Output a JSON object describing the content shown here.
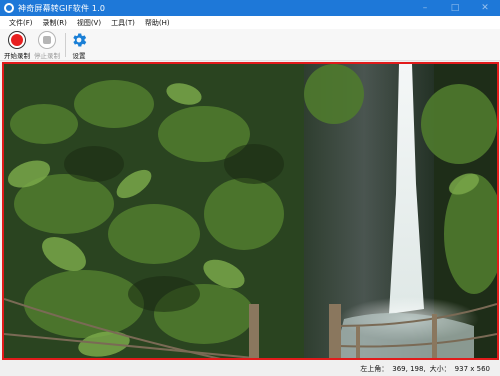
{
  "window": {
    "title": "神奇屏幕转GIF软件 1.0",
    "controls": [
      "–",
      "□",
      "✕"
    ]
  },
  "menu": {
    "items": [
      "文件(F)",
      "录制(R)",
      "视图(V)",
      "工具(T)",
      "帮助(H)"
    ]
  },
  "toolbar": {
    "record_label": "开始录制",
    "stop_label": "停止录制",
    "settings_label": "设置"
  },
  "capture": {
    "scene": "jungle-waterfall"
  },
  "status": {
    "position_label": "左上角：",
    "position_value": "369, 198,",
    "size_label": "大小：",
    "size_value": "937 x 560"
  },
  "colors": {
    "titlebar": "#1e78d8",
    "record_red": "#e81f1f",
    "capture_border": "#e21b1b",
    "settings_blue": "#1a7fd6"
  }
}
